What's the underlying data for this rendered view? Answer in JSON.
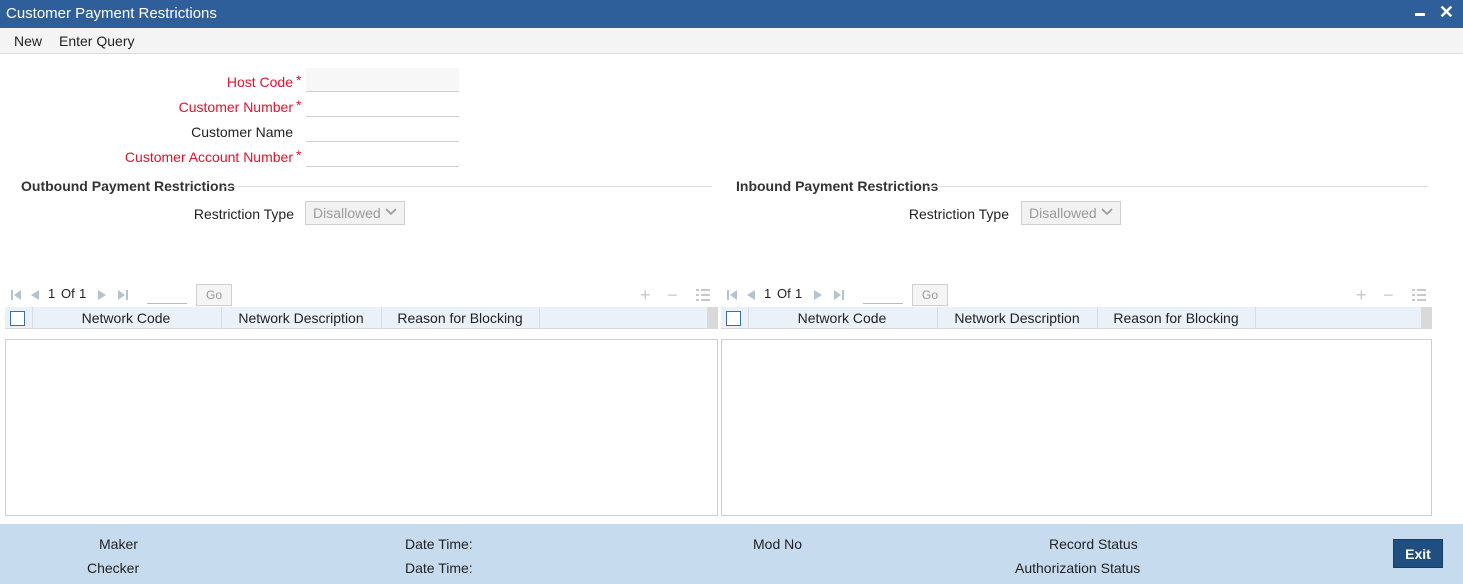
{
  "window": {
    "title": "Customer Payment Restrictions"
  },
  "menu": {
    "new_label": "New",
    "enter_query_label": "Enter Query"
  },
  "form": {
    "host_code_label": "Host Code",
    "host_code_value": "",
    "customer_number_label": "Customer Number",
    "customer_number_value": "",
    "customer_name_label": "Customer Name",
    "customer_name_value": "",
    "customer_account_number_label": "Customer Account Number",
    "customer_account_number_value": "",
    "required_marker": "*"
  },
  "outbound": {
    "section_title": "Outbound Payment Restrictions",
    "restriction_type_label": "Restriction Type",
    "restriction_type_value": "Disallowed",
    "grid": {
      "page_current": "1",
      "page_of": "Of",
      "page_total": "1",
      "go_label": "Go",
      "columns": [
        "Network Code",
        "Network Description",
        "Reason for Blocking"
      ],
      "rows": []
    }
  },
  "inbound": {
    "section_title": "Inbound Payment Restrictions",
    "restriction_type_label": "Restriction Type",
    "restriction_type_value": "Disallowed",
    "grid": {
      "page_current": "1",
      "page_of": "Of",
      "page_total": "1",
      "go_label": "Go",
      "columns": [
        "Network Code",
        "Network Description",
        "Reason for Blocking"
      ],
      "rows": []
    }
  },
  "footer": {
    "maker_label": "Maker",
    "checker_label": "Checker",
    "date_time_label_1": "Date Time:",
    "date_time_label_2": "Date Time:",
    "mod_no_label": "Mod No",
    "record_status_label": "Record Status",
    "authorization_status_label": "Authorization Status",
    "exit_label": "Exit"
  },
  "colors": {
    "title_bar": "#2f5f9a",
    "required_label": "#e8112d",
    "footer_bg": "#c6dbee",
    "exit_button": "#1f4f80"
  },
  "icons": [
    "minimize-icon",
    "close-icon",
    "first-page-icon",
    "prev-page-icon",
    "next-page-icon",
    "last-page-icon",
    "add-row-icon",
    "delete-row-icon",
    "single-view-icon",
    "chevron-down-icon"
  ]
}
